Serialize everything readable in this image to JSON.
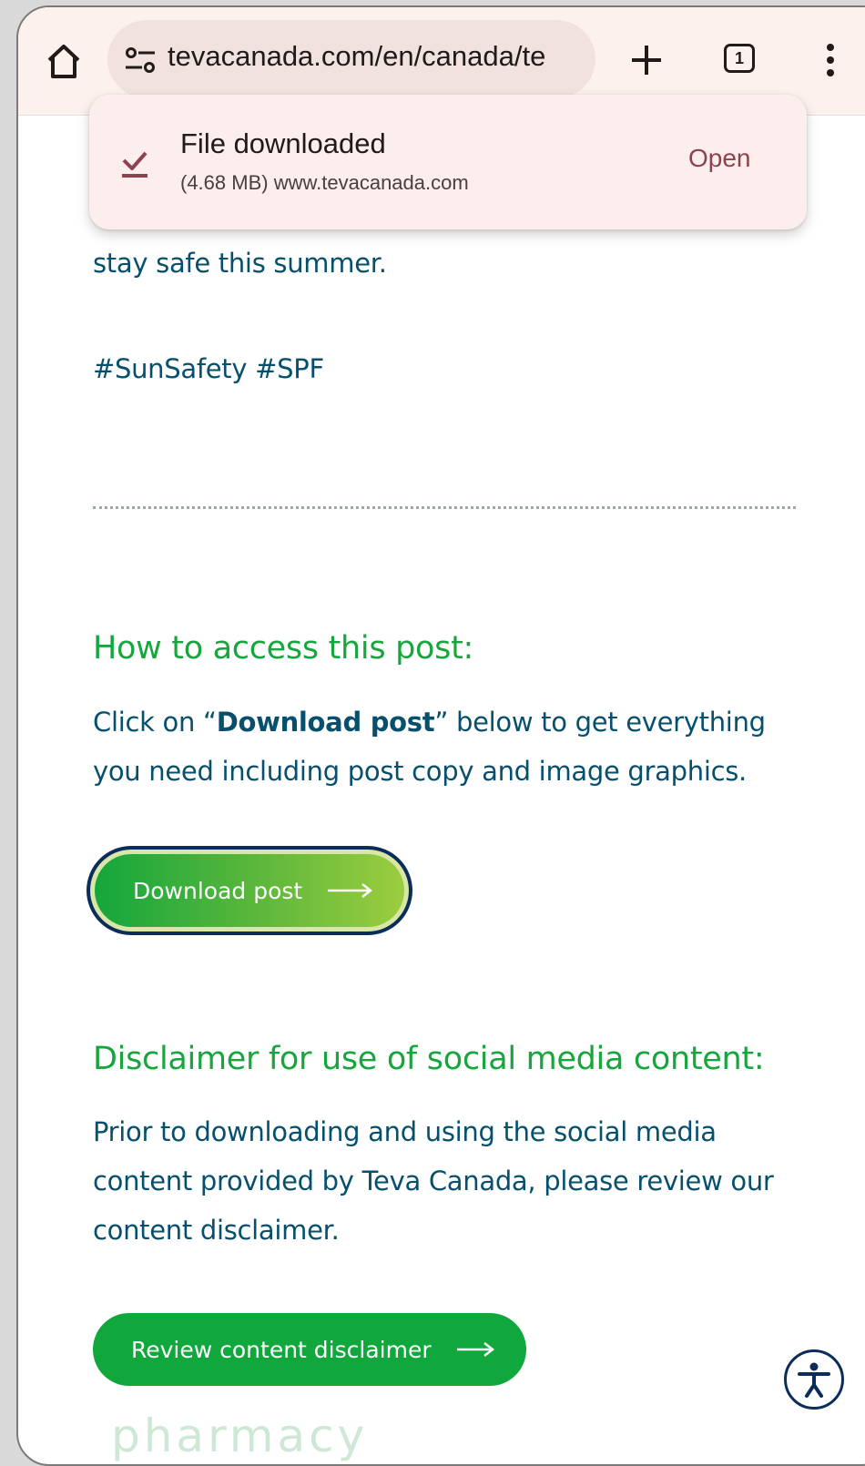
{
  "browser": {
    "url": "tevacanada.com/en/canada/te",
    "tab_count": "1"
  },
  "toast": {
    "title": "File downloaded",
    "subtitle": "(4.68 MB) www.tevacanada.com",
    "action_label": "Open"
  },
  "page": {
    "intro_tail": "stay safe this summer.",
    "hashtags": "#SunSafety #SPF",
    "access_heading": "How to access this post:",
    "access_text_before": "Click on “",
    "access_text_bold": "Download post",
    "access_text_after": "” below to get everything you need including post copy and image graphics.",
    "download_button_label": "Download post",
    "disclaimer_heading": "Disclaimer for use of social media content:",
    "disclaimer_text": "Prior to downloading and using the social media content provided by Teva Canada, please review our content disclaimer.",
    "review_button_label": "Review content disclaimer",
    "bottom_peek": "pharmacy"
  },
  "colors": {
    "brand_green": "#10a83c",
    "text_teal": "#06506e",
    "toast_action": "#8e4150"
  },
  "icons": [
    "home-icon",
    "site-settings-icon",
    "plus-icon",
    "tab-switcher-icon",
    "more-vert-icon",
    "download-check-icon",
    "arrow-right-icon",
    "accessibility-icon"
  ]
}
